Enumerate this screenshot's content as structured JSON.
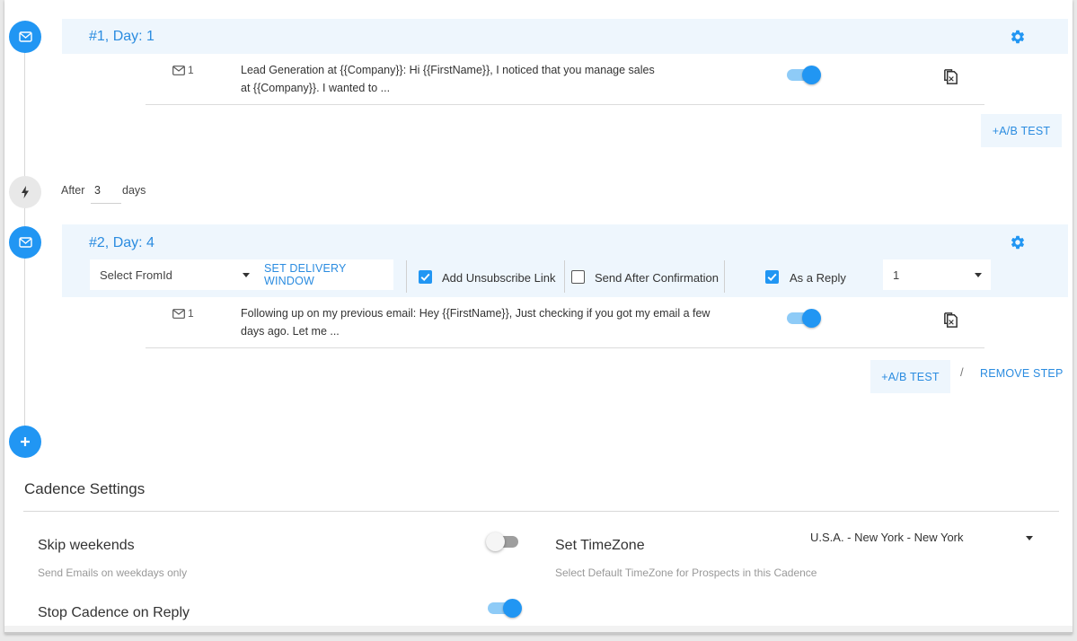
{
  "steps": [
    {
      "title": "#1, Day: 1",
      "email": {
        "count": "1",
        "line1": "Lead Generation at {{Company}}: Hi {{FirstName}},   I noticed that you manage sales",
        "line2": "at {{Company}}. I wanted to ...",
        "enabled": true
      },
      "ab_test_label": "+A/B TEST"
    },
    {
      "title": "#2, Day: 4",
      "from_select_placeholder": "Select FromId",
      "delivery_window_label": "SET DELIVERY WINDOW",
      "unsubscribe": {
        "label": "Add Unsubscribe Link",
        "checked": true
      },
      "send_after_confirmation": {
        "label": "Send After Confirmation",
        "checked": false
      },
      "as_reply": {
        "label": "As a Reply",
        "checked": true
      },
      "reply_select_value": "1",
      "email": {
        "count": "1",
        "line1": "Following up on my previous email: Hey {{FirstName}},   Just checking if you got my email a few",
        "line2": "days ago.   Let me ...",
        "enabled": true
      },
      "ab_test_label": "+A/B TEST",
      "separator": "/",
      "remove_step_label": "REMOVE STEP"
    }
  ],
  "delay": {
    "prefix": "After",
    "value": "3",
    "suffix": "days"
  },
  "icons": {
    "step_icon": "mail-icon",
    "delay_icon": "lightning-icon",
    "add_icon": "plus-icon",
    "settings_icon": "gear-icon",
    "copy_icon": "copy-icon"
  },
  "cadence_settings": {
    "title": "Cadence Settings",
    "skip_weekends": {
      "label": "Skip weekends",
      "sub": "Send Emails on weekdays only",
      "enabled": false
    },
    "timezone": {
      "label": "Set TimeZone",
      "sub": "Select Default TimeZone for Prospects in this Cadence",
      "value": "U.S.A. - New York - New York"
    },
    "stop_on_reply": {
      "label": "Stop Cadence on Reply",
      "enabled": true
    }
  },
  "colors": {
    "accent": "#2196f3",
    "link": "#2b8ce0",
    "header_bg": "#eef6fd"
  }
}
